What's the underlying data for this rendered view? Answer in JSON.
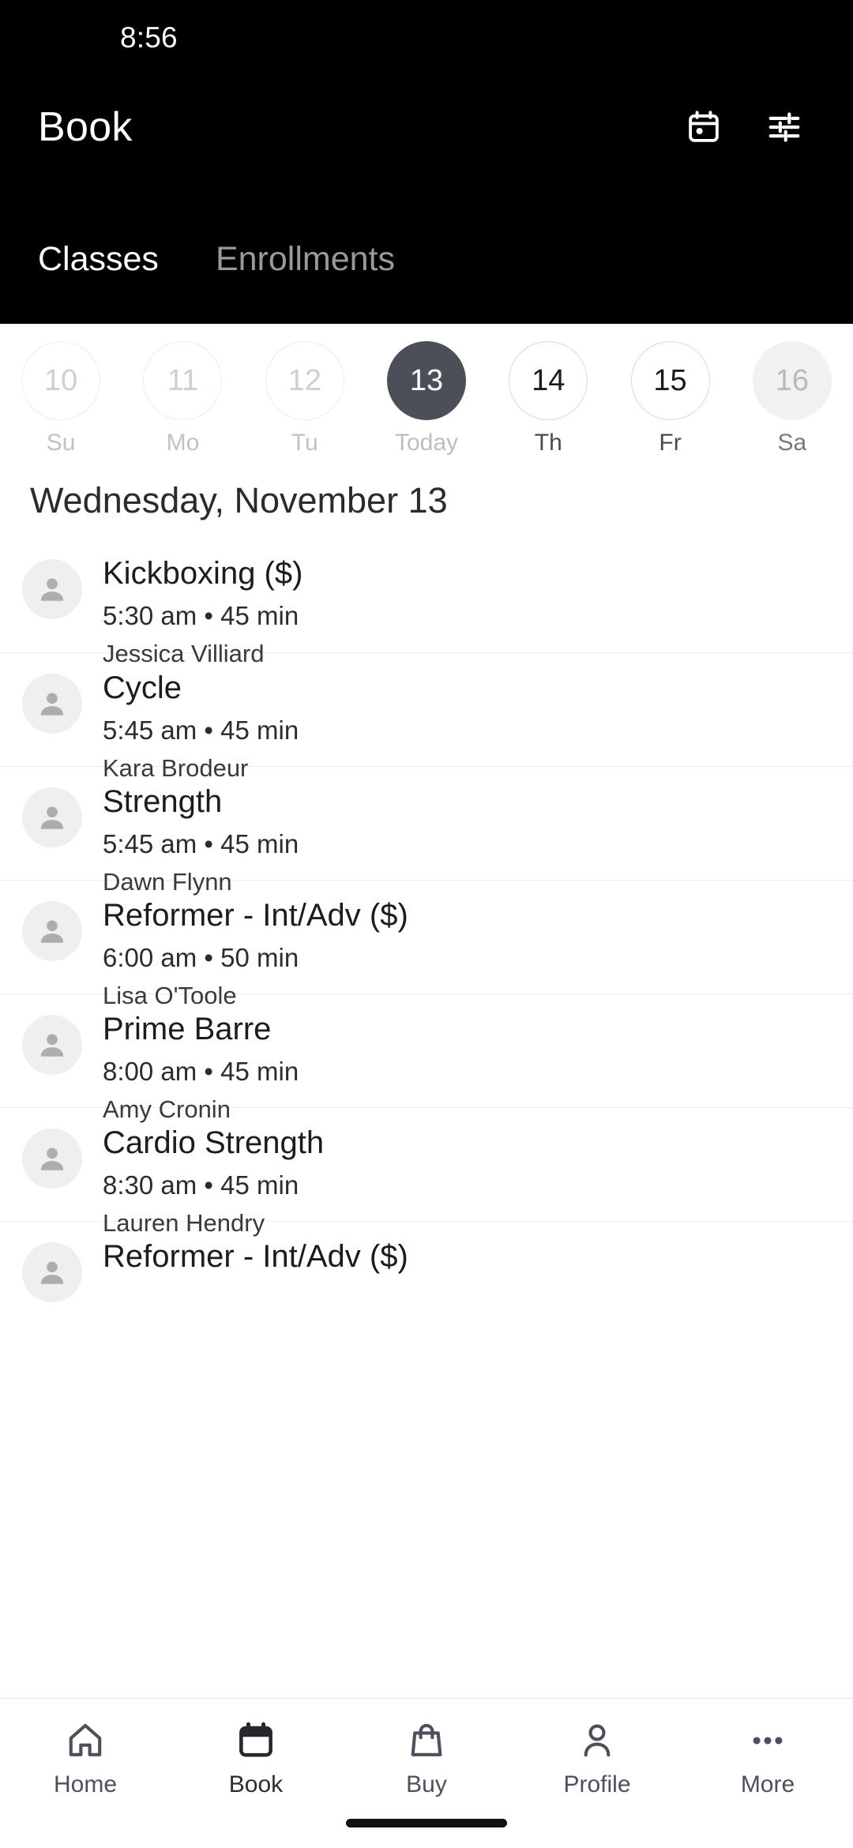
{
  "status_bar": {
    "time": "8:56"
  },
  "header": {
    "title": "Book",
    "actions": [
      {
        "name": "calendar-picker-icon",
        "label": "calendar-icon"
      },
      {
        "name": "filter-icon",
        "label": "tune-icon"
      }
    ],
    "tabs": [
      {
        "label": "Classes",
        "active": true
      },
      {
        "label": "Enrollments",
        "active": false
      }
    ]
  },
  "date_strip": [
    {
      "day": "10",
      "weekday": "Su",
      "state": "past"
    },
    {
      "day": "11",
      "weekday": "Mo",
      "state": "past"
    },
    {
      "day": "12",
      "weekday": "Tu",
      "state": "past"
    },
    {
      "day": "13",
      "weekday": "Today",
      "state": "selected"
    },
    {
      "day": "14",
      "weekday": "Th",
      "state": "future"
    },
    {
      "day": "15",
      "weekday": "Fr",
      "state": "future"
    },
    {
      "day": "16",
      "weekday": "Sa",
      "state": "weekend"
    }
  ],
  "day_heading": "Wednesday, November 13",
  "classes": [
    {
      "title": "Kickboxing ($)",
      "meta": "5:30 am • 45 min",
      "instructor": "Jessica Villiard"
    },
    {
      "title": "Cycle",
      "meta": "5:45 am • 45 min",
      "instructor": "Kara Brodeur"
    },
    {
      "title": "Strength",
      "meta": "5:45 am • 45 min",
      "instructor": "Dawn Flynn"
    },
    {
      "title": "Reformer - Int/Adv ($)",
      "meta": "6:00 am • 50 min",
      "instructor": "Lisa O'Toole"
    },
    {
      "title": "Prime Barre",
      "meta": "8:00 am • 45 min",
      "instructor": "Amy Cronin"
    },
    {
      "title": "Cardio Strength",
      "meta": "8:30 am • 45 min",
      "instructor": "Lauren Hendry"
    },
    {
      "title": "Reformer - Int/Adv ($)",
      "meta": "",
      "instructor": ""
    }
  ],
  "bottom_nav": [
    {
      "label": "Home",
      "icon": "home-icon",
      "active": false
    },
    {
      "label": "Book",
      "icon": "calendar-icon",
      "active": true
    },
    {
      "label": "Buy",
      "icon": "shopping-bag-icon",
      "active": false
    },
    {
      "label": "Profile",
      "icon": "person-icon",
      "active": false
    },
    {
      "label": "More",
      "icon": "more-horizontal-icon",
      "active": false
    }
  ],
  "colors": {
    "header_bg": "#000000",
    "selected_day_bg": "#4b4f58",
    "weekend_day_bg": "#f1f1f1",
    "avatar_bg": "#efefef",
    "nav_icon": "#4c505a",
    "nav_icon_active": "#2a2d33"
  }
}
